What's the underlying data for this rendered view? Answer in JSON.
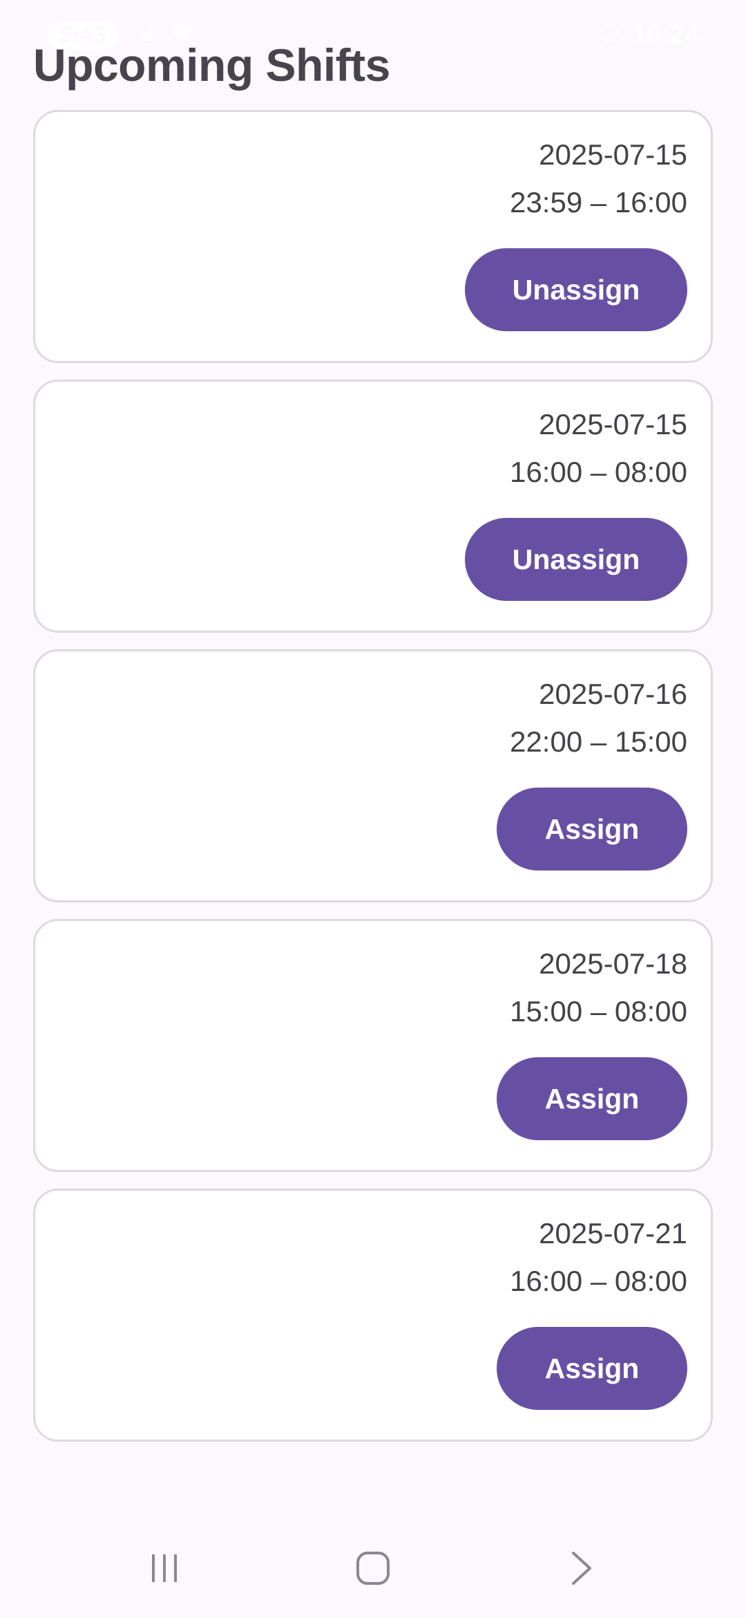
{
  "status_bar": {
    "time": "10:24",
    "left_pill": "5:43"
  },
  "page": {
    "title": "Upcoming Shifts"
  },
  "shifts": [
    {
      "date": "2025-07-15",
      "time": "23:59 – 16:00",
      "action": "Unassign"
    },
    {
      "date": "2025-07-15",
      "time": "16:00 – 08:00",
      "action": "Unassign"
    },
    {
      "date": "2025-07-16",
      "time": "22:00 – 15:00",
      "action": "Assign"
    },
    {
      "date": "2025-07-18",
      "time": "15:00 – 08:00",
      "action": "Assign"
    },
    {
      "date": "2025-07-21",
      "time": "16:00 – 08:00",
      "action": "Assign"
    }
  ],
  "nav": {
    "recents_icon": "recents-icon",
    "home_icon": "home-icon",
    "back_icon": "back-chevron-icon"
  },
  "colors": {
    "background": "#fdf7fe",
    "button": "#6750a4",
    "card_border": "#dcd9df",
    "text": "#44414a"
  }
}
